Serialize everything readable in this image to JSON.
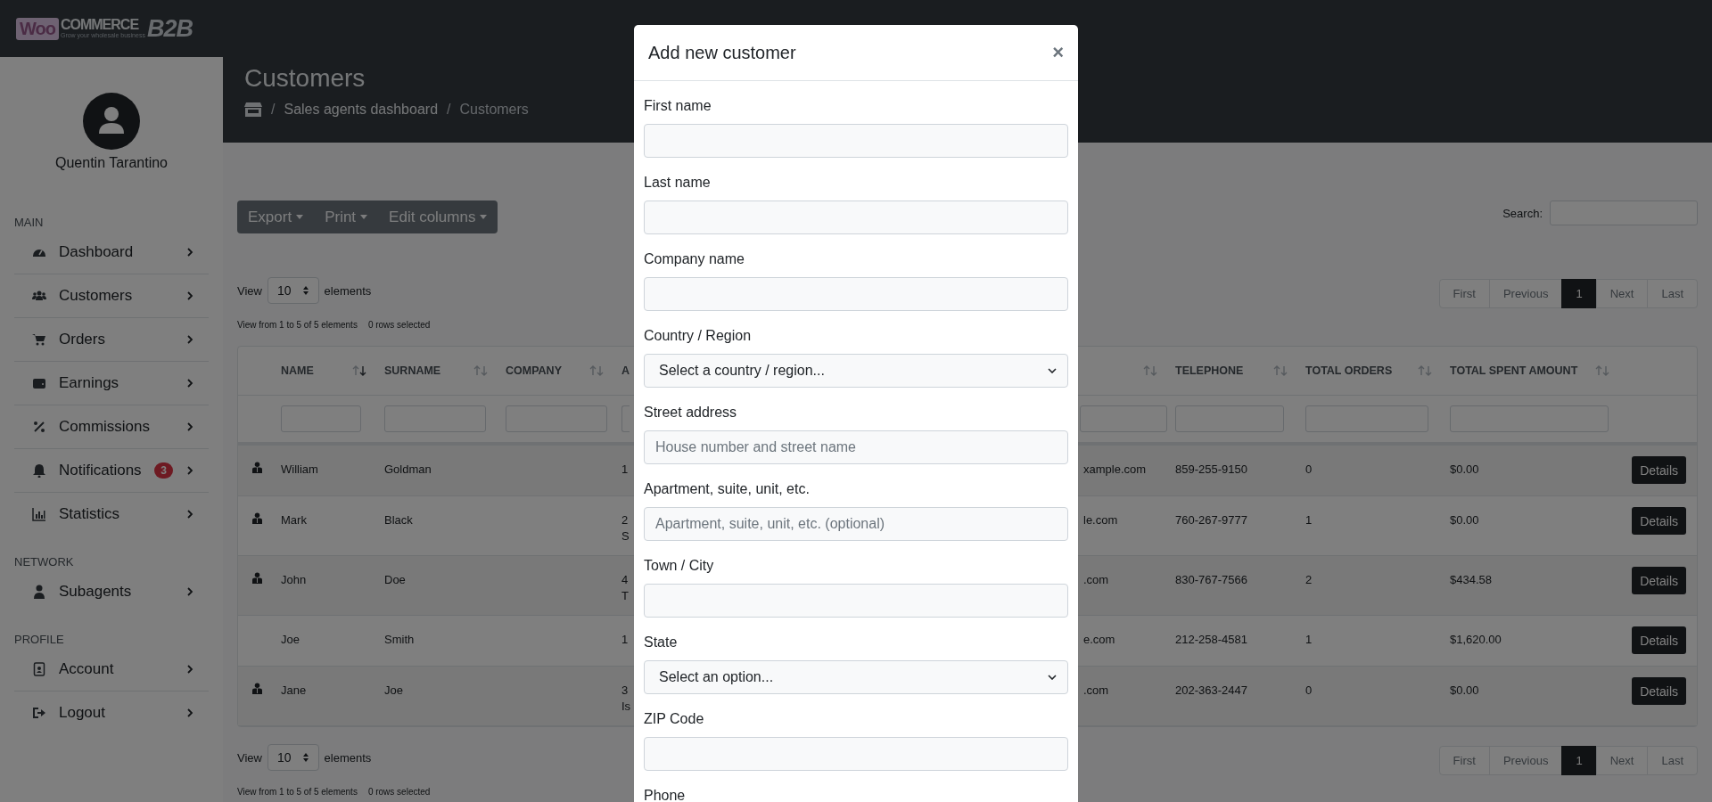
{
  "logo": {
    "woo": "Woo",
    "commerce": "COMMERCE",
    "b2b": "B2B",
    "tagline": "Grow your wholesale business"
  },
  "user": {
    "name": "Quentin Tarantino"
  },
  "sidebar": {
    "sections": [
      {
        "title": "MAIN",
        "items": [
          {
            "label": "Dashboard"
          },
          {
            "label": "Customers"
          },
          {
            "label": "Orders"
          },
          {
            "label": "Earnings"
          },
          {
            "label": "Commissions"
          },
          {
            "label": "Notifications",
            "badge": "3"
          },
          {
            "label": "Statistics"
          }
        ]
      },
      {
        "title": "NETWORK",
        "items": [
          {
            "label": "Subagents"
          }
        ]
      },
      {
        "title": "PROFILE",
        "items": [
          {
            "label": "Account"
          },
          {
            "label": "Logout"
          }
        ]
      }
    ]
  },
  "page": {
    "title": "Customers",
    "separator": "/",
    "breadcrumb": [
      "Sales agents dashboard",
      "Customers"
    ]
  },
  "toolbar": {
    "buttons": [
      "Export",
      "Print",
      "Edit columns"
    ],
    "search_label": "Search:"
  },
  "view_top": {
    "prefix": "View",
    "value": "10",
    "suffix": "elements",
    "info": "View from 1 to 5 of 5 elements",
    "selected": "0 rows selected"
  },
  "pagination_top": [
    {
      "label": "First",
      "selected": false
    },
    {
      "label": "Previous",
      "selected": false
    },
    {
      "label": "1",
      "selected": true
    },
    {
      "label": "Next",
      "selected": false
    },
    {
      "label": "Last",
      "selected": false
    }
  ],
  "table": {
    "columns": [
      {
        "label": "NAME",
        "sorted": true
      },
      {
        "label": "SURNAME",
        "sorted": false
      },
      {
        "label": "COMPANY",
        "sorted": false
      },
      {
        "label": "A"
      },
      {
        "sorted": false
      },
      {
        "label": "TELEPHONE",
        "sorted": false
      },
      {
        "label": "TOTAL ORDERS",
        "sorted": false
      },
      {
        "label": "TOTAL SPENT AMOUNT",
        "sorted": false
      }
    ],
    "rows": [
      {
        "user_icon": true,
        "cells": [
          "William",
          "Goldman",
          "",
          [
            "1"
          ],
          "xample.com",
          "859-255-9150",
          "0",
          "$0.00"
        ],
        "action": "Details"
      },
      {
        "user_icon": true,
        "cells": [
          "Mark",
          "Black",
          "",
          [
            "2",
            "S"
          ],
          "le.com",
          "760-267-9777",
          "1",
          "$0.00"
        ],
        "action": "Details"
      },
      {
        "user_icon": true,
        "cells": [
          "John",
          "Doe",
          "",
          [
            "4",
            "T"
          ],
          ".com",
          "830-767-7566",
          "2",
          "$434.58"
        ],
        "action": "Details"
      },
      {
        "user_icon": false,
        "cells": [
          "Joe",
          "Smith",
          "",
          [
            "1"
          ],
          "e.com",
          "212-258-4581",
          "1",
          "$1,620.00"
        ],
        "action": "Details"
      },
      {
        "user_icon": true,
        "cells": [
          "Jane",
          "Joe",
          "",
          [
            "3",
            "Is"
          ],
          ".com",
          "202-363-2447",
          "0",
          "$0.00"
        ],
        "action": "Details"
      }
    ]
  },
  "view_bottom": {
    "prefix": "View",
    "value": "10",
    "suffix": "elements",
    "info": "View from 1 to 5 of 5 elements",
    "selected": "0 rows selected"
  },
  "pagination_bottom": [
    {
      "label": "First",
      "selected": false
    },
    {
      "label": "Previous",
      "selected": false
    },
    {
      "label": "1",
      "selected": true
    },
    {
      "label": "Next",
      "selected": false
    },
    {
      "label": "Last",
      "selected": false
    }
  ],
  "modal": {
    "title": "Add new customer",
    "close": "×",
    "fields": [
      {
        "label": "First name",
        "kind": "input"
      },
      {
        "label": "Last name",
        "kind": "input"
      },
      {
        "label": "Company name",
        "kind": "input"
      },
      {
        "label": "Country / Region",
        "kind": "select",
        "value": "Select a country / region..."
      },
      {
        "label": "Street address",
        "kind": "input",
        "placeholder": "House number and street name"
      },
      {
        "label": "Apartment, suite, unit, etc.",
        "kind": "input",
        "placeholder": "Apartment, suite, unit, etc. (optional)"
      },
      {
        "label": "Town / City",
        "kind": "input"
      },
      {
        "label": "State",
        "kind": "select",
        "value": "Select an option..."
      },
      {
        "label": "ZIP Code",
        "kind": "input"
      },
      {
        "label": "Phone"
      }
    ]
  }
}
